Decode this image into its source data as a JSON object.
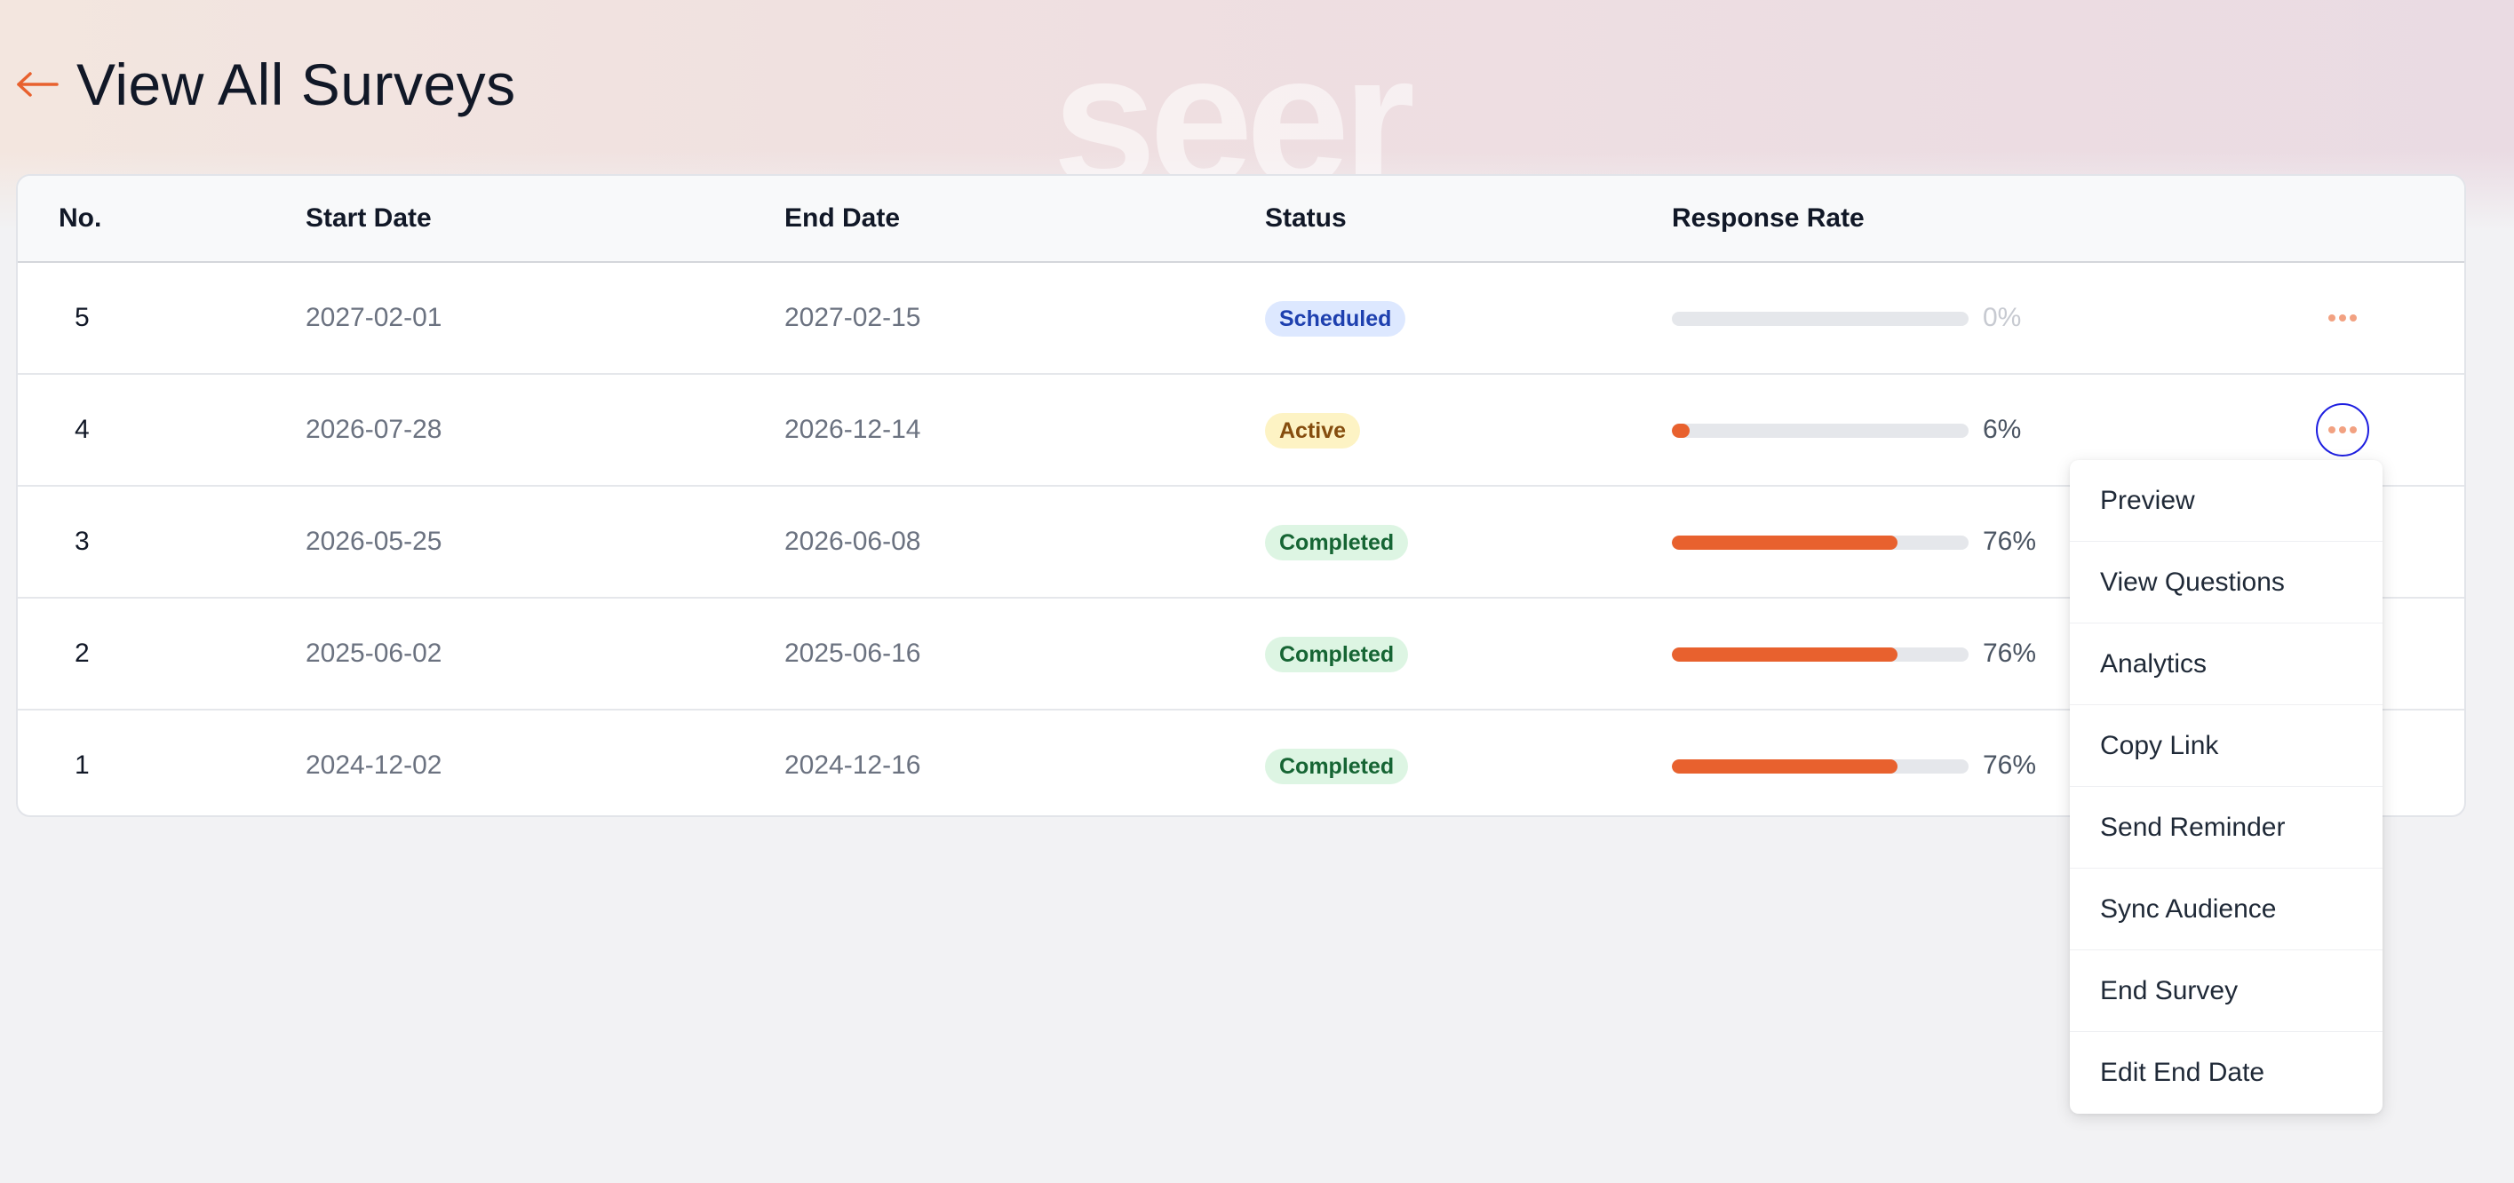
{
  "header": {
    "title": "View All Surveys",
    "back_icon": "arrow-left-icon"
  },
  "watermark": "seer",
  "colors": {
    "accent": "#e8612e",
    "scheduled_bg": "#dde8ff",
    "active_bg": "#fdf3c4",
    "completed_bg": "#ddf5e3",
    "focus_ring": "#1d1ee0"
  },
  "table": {
    "columns": [
      "No.",
      "Start Date",
      "End Date",
      "Status",
      "Response Rate"
    ],
    "rows": [
      {
        "no": "5",
        "start": "2027-02-01",
        "end": "2027-02-15",
        "status": "Scheduled",
        "status_kind": "scheduled",
        "rate_label": "0%",
        "rate": 0
      },
      {
        "no": "4",
        "start": "2026-07-28",
        "end": "2026-12-14",
        "status": "Active",
        "status_kind": "active",
        "rate_label": "6%",
        "rate": 0.06
      },
      {
        "no": "3",
        "start": "2026-05-25",
        "end": "2026-06-08",
        "status": "Completed",
        "status_kind": "completed",
        "rate_label": "76%",
        "rate": 0.76
      },
      {
        "no": "2",
        "start": "2025-06-02",
        "end": "2025-06-16",
        "status": "Completed",
        "status_kind": "completed",
        "rate_label": "76%",
        "rate": 0.76
      },
      {
        "no": "1",
        "start": "2024-12-02",
        "end": "2024-12-16",
        "status": "Completed",
        "status_kind": "completed",
        "rate_label": "76%",
        "rate": 0.76
      }
    ]
  },
  "actions_menu": {
    "open_for_row": "4",
    "items": [
      "Preview",
      "View Questions",
      "Analytics",
      "Copy Link",
      "Send Reminder",
      "Sync Audience",
      "End Survey",
      "Edit End Date"
    ]
  }
}
